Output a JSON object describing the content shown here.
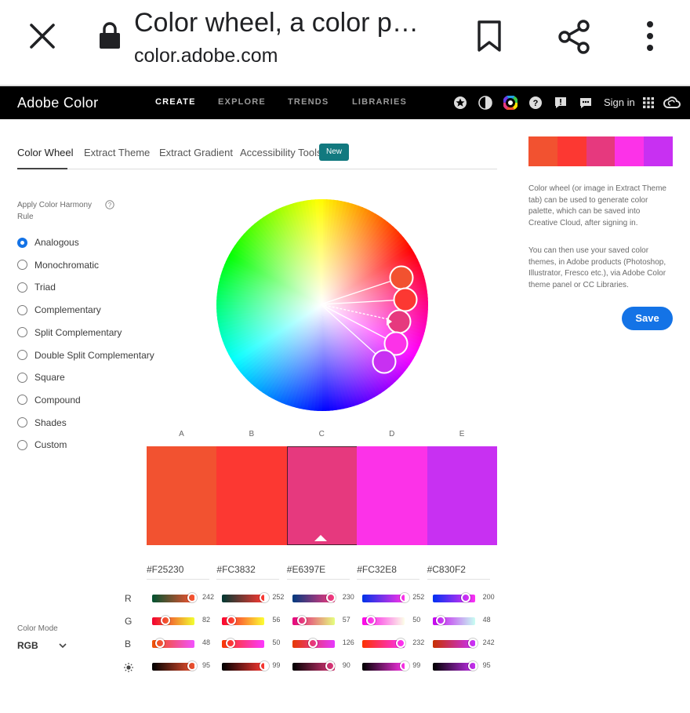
{
  "browser": {
    "title": "Color wheel, a color p…",
    "url": "color.adobe.com"
  },
  "nav": {
    "brand": "Adobe Color",
    "links": [
      "CREATE",
      "EXPLORE",
      "TRENDS",
      "LIBRARIES"
    ],
    "active": "CREATE",
    "sign_in": "Sign in"
  },
  "tabs": {
    "items": [
      "Color Wheel",
      "Extract Theme",
      "Extract Gradient",
      "Accessibility Tools"
    ],
    "badge": "New"
  },
  "harmony": {
    "title": "Apply Color Harmony Rule",
    "options": [
      "Analogous",
      "Monochromatic",
      "Triad",
      "Complementary",
      "Split Complementary",
      "Double Split Complementary",
      "Square",
      "Compound",
      "Shades",
      "Custom"
    ],
    "selected": "Analogous"
  },
  "swatches": [
    {
      "label": "A",
      "color": "#F25230",
      "hex": "#F25230",
      "r": 242,
      "g": 82,
      "b": 48,
      "brightness": 95
    },
    {
      "label": "B",
      "color": "#FC3832",
      "hex": "#FC3832",
      "r": 252,
      "g": 56,
      "b": 50,
      "brightness": 99
    },
    {
      "label": "C",
      "color": "#E6397E",
      "hex": "#E6397E",
      "r": 230,
      "g": 57,
      "b": 126,
      "brightness": 90
    },
    {
      "label": "D",
      "color": "#FC32E8",
      "hex": "#FC32E8",
      "r": 252,
      "g": 50,
      "b": 232,
      "brightness": 99
    },
    {
      "label": "E",
      "color": "#C830F2",
      "hex": "#C830F2",
      "r": 200,
      "g": 48,
      "b": 242,
      "brightness": 95
    }
  ],
  "channels": [
    "R",
    "G",
    "B"
  ],
  "color_mode": {
    "label": "Color Mode",
    "value": "RGB"
  },
  "right_panel": {
    "desc1": "Color wheel (or image in Extract Theme tab) can be used to generate color palette, which can be saved into Creative Cloud, after signing in.",
    "desc2": "You can then use your saved color themes, in Adobe products (Photoshop, Illustrator, Fresco etc.), via Adobe Color theme panel or CC Libraries.",
    "save_label": "Save"
  },
  "icons": {
    "close": "close-icon",
    "lock": "lock-icon",
    "bookmark": "bookmark-icon",
    "share": "share-icon",
    "menu": "more-vert-icon",
    "brightness": "brightness-icon"
  }
}
